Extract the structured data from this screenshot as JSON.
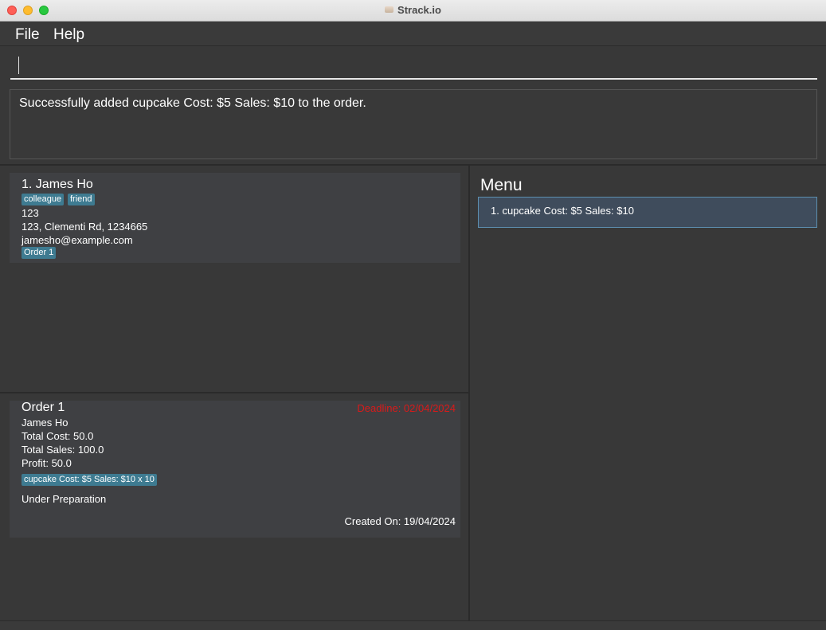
{
  "window": {
    "title": "Strack.io"
  },
  "menubar": {
    "file": "File",
    "help": "Help"
  },
  "command": {
    "value": ""
  },
  "result": {
    "text": "Successfully added cupcake Cost: $5 Sales: $10 to the order."
  },
  "persons": [
    {
      "title": "1.  James Ho",
      "tags": [
        "colleague",
        "friend"
      ],
      "phone": "123",
      "address": "123, Clementi Rd, 1234665",
      "email": "jamesho@example.com",
      "orders": [
        "Order 1"
      ]
    }
  ],
  "orders": [
    {
      "title": "Order 1",
      "deadline": "Deadline: 02/04/2024",
      "customer": "James Ho",
      "total_cost": "Total Cost: 50.0",
      "total_sales": "Total Sales: 100.0",
      "profit": "Profit: 50.0",
      "products": [
        "cupcake Cost: $5 Sales: $10 x 10"
      ],
      "status": "Under Preparation",
      "created": "Created On: 19/04/2024"
    }
  ],
  "menu": {
    "title": "Menu",
    "items": [
      "1. cupcake  Cost: $5  Sales: $10"
    ]
  },
  "status_bar": {
    "text": ""
  },
  "colors": {
    "tag": "#3e7b91",
    "deadline": "#d91a1a",
    "selected_row": "#3f4c5c"
  }
}
